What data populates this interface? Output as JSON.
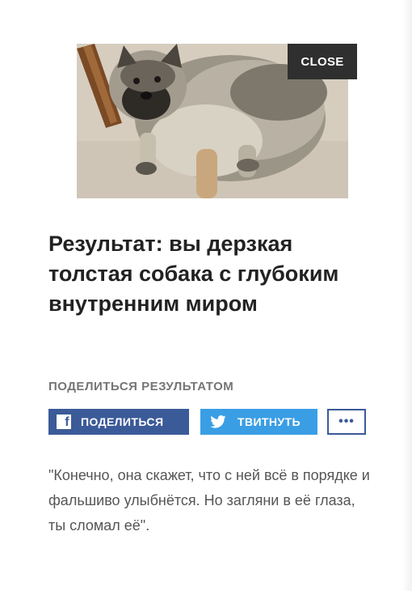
{
  "photo": {
    "alt_icon": "dog-photo"
  },
  "close_label": "CLOSE",
  "result": {
    "title": "Результат: вы дерзкая толстая собака с глубоким внутренним миром"
  },
  "share": {
    "label": "ПОДЕЛИТЬСЯ РЕЗУЛЬТАТОМ",
    "facebook_label": "ПОДЕЛИТЬСЯ",
    "twitter_label": "ТВИТНУТЬ",
    "more_label": "•••",
    "facebook_icon": "facebook-icon",
    "twitter_icon": "twitter-icon",
    "colors": {
      "facebook": "#3b5a98",
      "twitter": "#3a9ee5"
    }
  },
  "quote": "\"Конечно, она скажет, что с ней всё в порядке и фальшиво улыбнётся. Но загляни в её глаза, ты сломал её\"."
}
